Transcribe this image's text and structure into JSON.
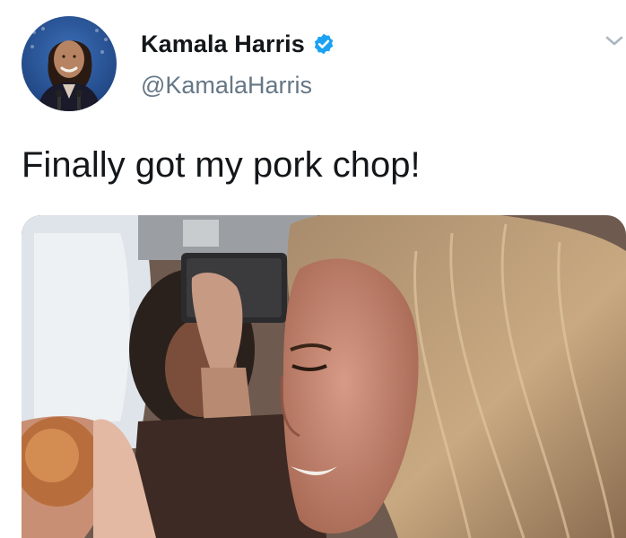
{
  "tweet": {
    "display_name": "Kamala Harris",
    "handle": "@KamalaHarris",
    "verified": true,
    "text": "Finally got my pork chop!",
    "icons": {
      "verified": "verified-badge-icon",
      "menu": "chevron-down-icon"
    },
    "colors": {
      "verified_badge": "#1da1f2",
      "handle": "#657786",
      "caret": "#aab8c2"
    }
  }
}
